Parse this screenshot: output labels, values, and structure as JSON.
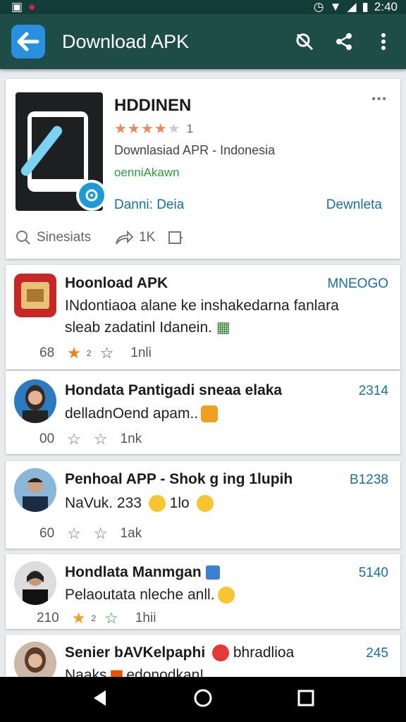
{
  "status": {
    "time": "2:40"
  },
  "toolbar": {
    "title": "Download APK"
  },
  "app": {
    "name": "HDDINEN",
    "rating_count": "1",
    "description": "Downlasiad APR - Indonesia",
    "subtitle": "oenniAkawn",
    "developer": "Danni: Deia",
    "download_label": "Dewnleta",
    "meta_label": "Sinesiats",
    "share_count": "1K"
  },
  "feed": [
    {
      "title": "Hoonload APK",
      "time": "MNEOGO",
      "line1": "INdontiaoa alane ke inshakedarna fanlara",
      "line2": "sleab zadatinl Idanein.",
      "count1": "68",
      "count2": "2",
      "count3": "1nli"
    },
    {
      "title": "Hondata Pantigadi sneaa elaka",
      "time": "2314",
      "line1": "delladnOend apam..",
      "count1": "00",
      "count3": "1nk"
    },
    {
      "title": "Penhoal APP - Shok g ing 1lupih",
      "time": "B1238",
      "line1": "NaVuk. 233",
      "line1b": "1lo",
      "count1": "60",
      "count3": "1ak"
    },
    {
      "title": "Hondlata Manmgan",
      "time": "5140",
      "line1": "Pelaoutata nleche anll.",
      "count1": "210",
      "count2": "2",
      "count3": "1hii"
    },
    {
      "title": "Senier bAVKelpaphi",
      "title_b": "bhradlioa",
      "time": "245",
      "line1": "Naaks",
      "line1b": "edonodkan!"
    }
  ],
  "colors": {
    "toolbar": "#1e4d47",
    "accent": "#1b6f9a",
    "back_button": "#2b8fe0"
  }
}
